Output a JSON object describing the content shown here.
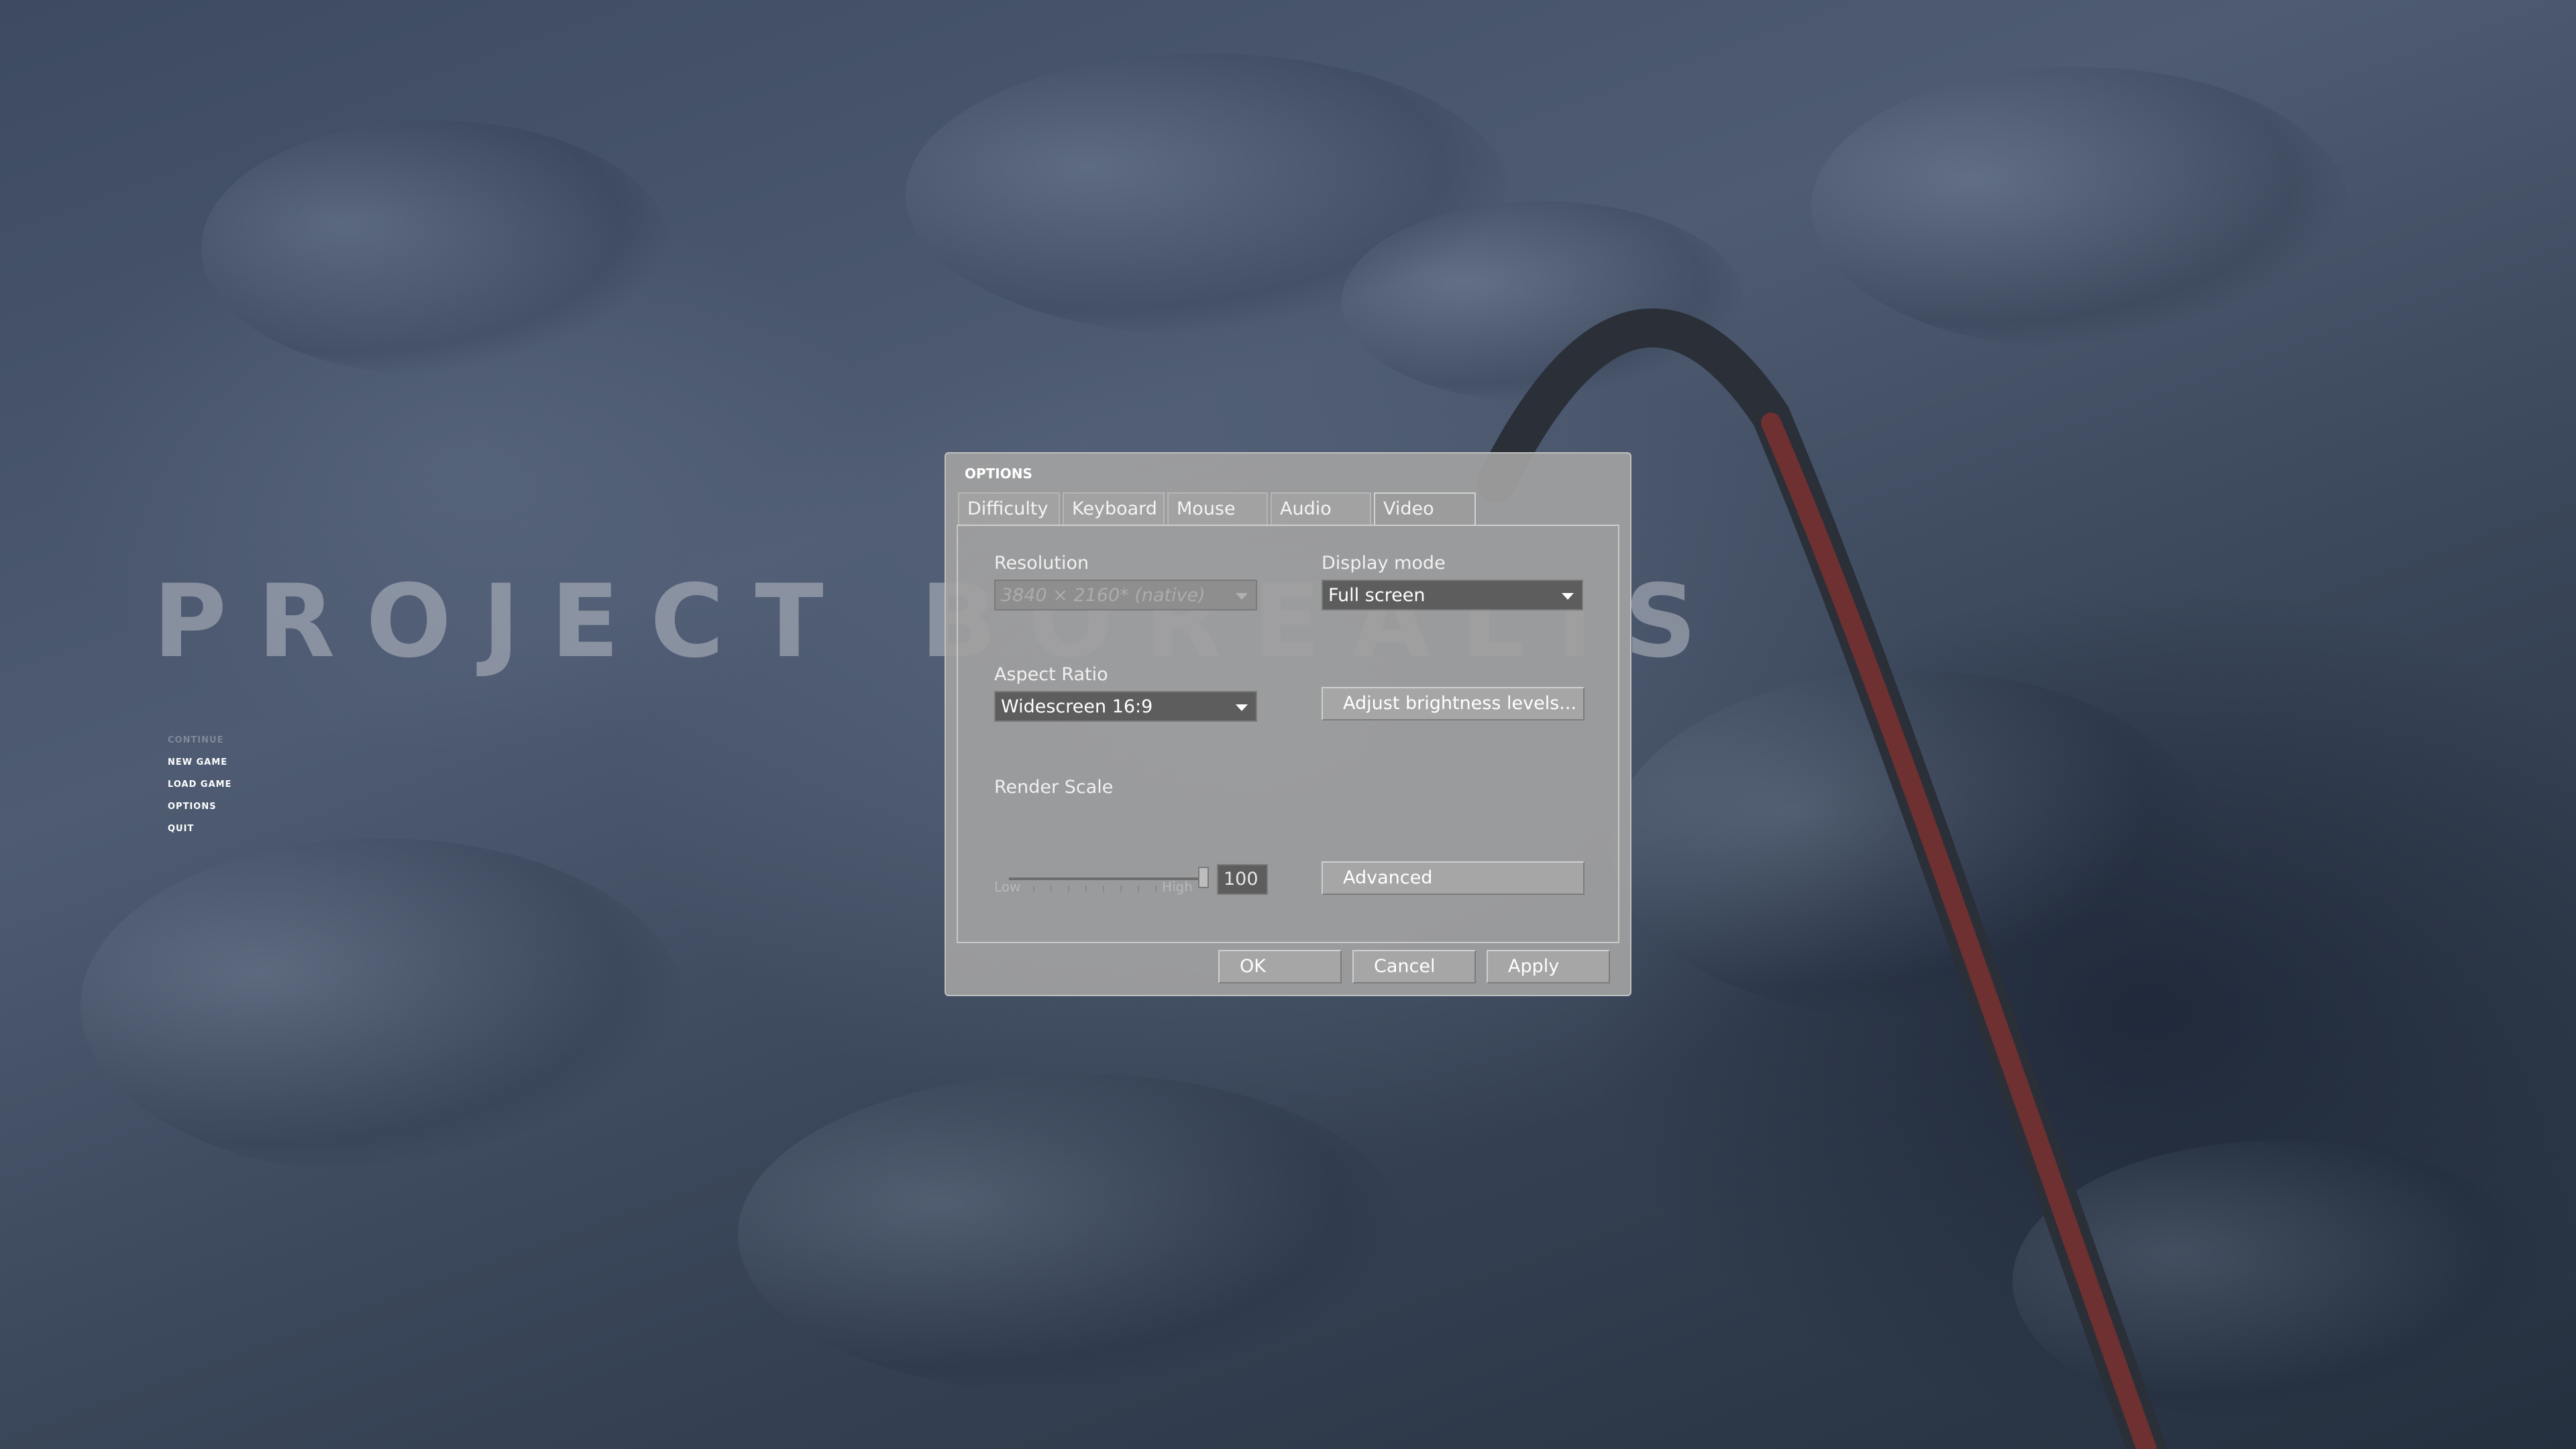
{
  "game": {
    "title": "PROJECT BOREALIS",
    "menu": [
      {
        "label": "CONTINUE",
        "enabled": false
      },
      {
        "label": "NEW GAME",
        "enabled": true
      },
      {
        "label": "LOAD GAME",
        "enabled": true
      },
      {
        "label": "OPTIONS",
        "enabled": true
      },
      {
        "label": "QUIT",
        "enabled": true
      }
    ]
  },
  "dialog": {
    "title": "OPTIONS",
    "tabs": [
      "Difficulty",
      "Keyboard",
      "Mouse",
      "Audio",
      "Video"
    ],
    "active_tab": "Video",
    "video": {
      "resolution_label": "Resolution",
      "resolution_value": "3840 × 2160* (native)",
      "display_mode_label": "Display mode",
      "display_mode_value": "Full screen",
      "aspect_label": "Aspect Ratio",
      "aspect_value": "Widescreen 16:9",
      "brightness_button": "Adjust brightness levels...",
      "render_scale_label": "Render Scale",
      "render_scale_value": "100",
      "render_scale_level": 1.0,
      "slider_low": "Low",
      "slider_high": "High",
      "advanced_button": "Advanced"
    },
    "buttons": {
      "ok": "OK",
      "cancel": "Cancel",
      "apply": "Apply"
    }
  },
  "colors": {
    "accent_pole": "#8a2f2f",
    "dialog_bg": "#a0a0a0"
  }
}
